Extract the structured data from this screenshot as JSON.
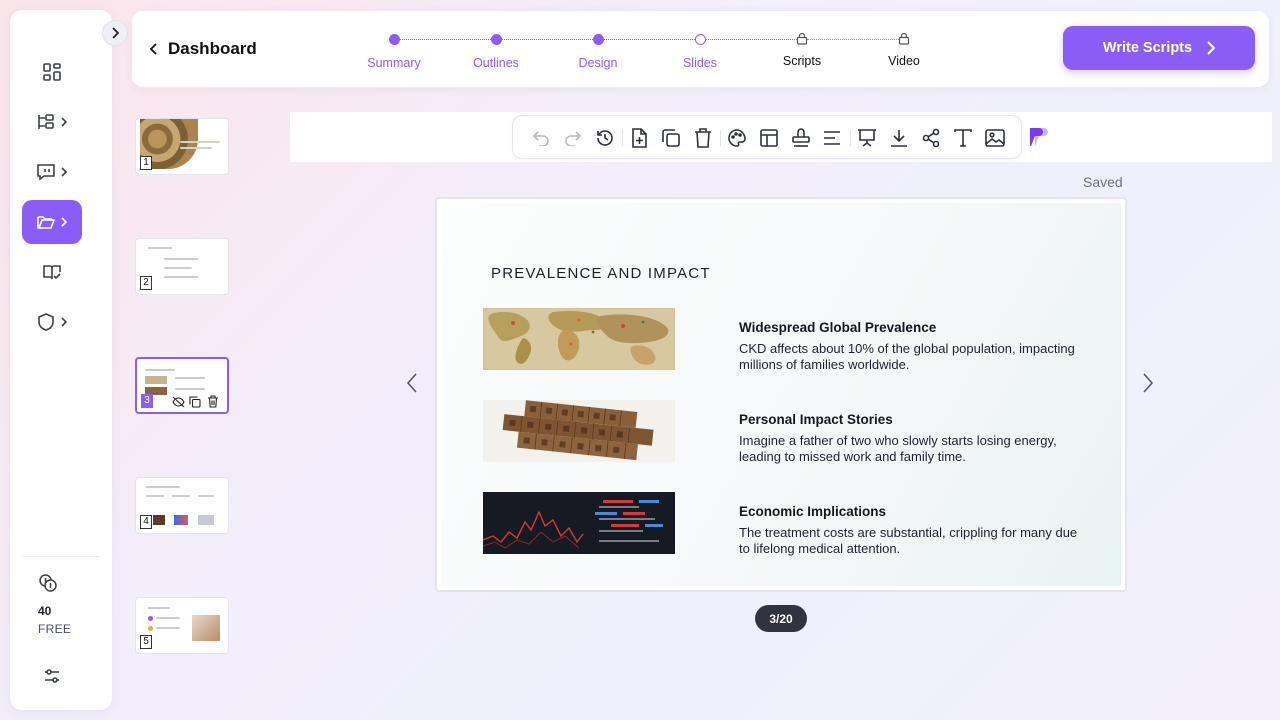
{
  "header": {
    "title": "Dashboard",
    "steps": [
      {
        "label": "Summary",
        "state": "done"
      },
      {
        "label": "Outlines",
        "state": "done"
      },
      {
        "label": "Design",
        "state": "done"
      },
      {
        "label": "Slides",
        "state": "current"
      },
      {
        "label": "Scripts",
        "state": "locked"
      },
      {
        "label": "Video",
        "state": "locked"
      }
    ],
    "cta_label": "Write Scripts"
  },
  "sidebar": {
    "items": [
      {
        "icon": "dashboard-grid-icon"
      },
      {
        "icon": "tree-structure-icon"
      },
      {
        "icon": "chat-bubble-icon"
      },
      {
        "icon": "folder-open-icon",
        "active": true
      },
      {
        "icon": "book-check-icon"
      },
      {
        "icon": "shield-icon"
      }
    ],
    "credits_value": "40",
    "plan_label": "FREE"
  },
  "status": {
    "saved_label": "Saved"
  },
  "thumbnails": [
    {
      "number": "1"
    },
    {
      "number": "2"
    },
    {
      "number": "3",
      "active": true
    },
    {
      "number": "4"
    },
    {
      "number": "5"
    }
  ],
  "toolbar": {
    "icons": [
      "undo-icon",
      "redo-icon",
      "history-icon",
      "add-slide-icon",
      "duplicate-icon",
      "delete-icon",
      "palette-icon",
      "layout-icon",
      "stamp-icon",
      "align-icon",
      "present-icon",
      "download-icon",
      "share-icon",
      "text-icon",
      "image-icon"
    ]
  },
  "slide": {
    "title": "PREVALENCE AND IMPACT",
    "items": [
      {
        "heading": "Widespread Global Prevalence",
        "body": "CKD affects about 10% of the global population, impacting millions of families worldwide.",
        "image": "world-map-image"
      },
      {
        "heading": "Personal Impact Stories",
        "body": "Imagine a father of two who slowly starts losing energy, leading to missed work and family time.",
        "image": "scrabble-tiles-image"
      },
      {
        "heading": "Economic Implications",
        "body": "The treatment costs are substantial, crippling for many due to lifelong medical attention.",
        "image": "stock-chart-image"
      }
    ]
  },
  "pager": {
    "label": "3/20"
  },
  "colors": {
    "accent": "#8b5cf6",
    "pager_bg": "#30343f"
  }
}
